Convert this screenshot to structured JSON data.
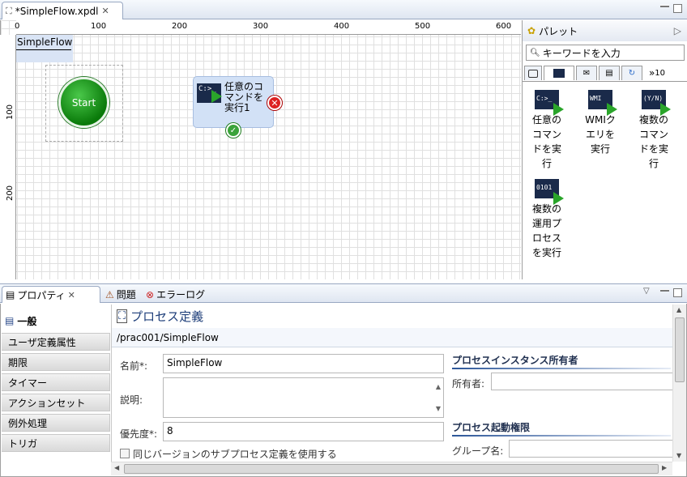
{
  "editor": {
    "tab_title": "*SimpleFlow.xpdl"
  },
  "ruler": {
    "top_ticks": [
      "0",
      "100",
      "200",
      "300",
      "400",
      "500",
      "600"
    ],
    "left_ticks": [
      "100",
      "200"
    ]
  },
  "canvas": {
    "flow_name": "SimpleFlow",
    "start_label": "Start",
    "task": {
      "label_line1": "任意のコ",
      "label_line2": "マンドを",
      "label_line3": "実行1",
      "icon_text": "C:>_"
    }
  },
  "palette": {
    "title": "パレット",
    "search_placeholder": "キーワードを入力",
    "tab_overflow": "»",
    "tab_count": "10",
    "items": [
      {
        "icon_text": "C:>_",
        "line1": "任意の",
        "line2": "コマン",
        "line3": "ドを実",
        "line4": "行"
      },
      {
        "icon_text": "WMI",
        "line1": "WMIク",
        "line2": "エリを",
        "line3": "実行",
        "line4": ""
      },
      {
        "icon_text": "(Y/N)",
        "line1": "複数の",
        "line2": "コマン",
        "line3": "ドを実",
        "line4": "行"
      },
      {
        "icon_text": "0101",
        "line1": "複数の",
        "line2": "運用プ",
        "line3": "ロセス",
        "line4": "を実行"
      }
    ]
  },
  "bottom_tabs": {
    "properties": "プロパティ",
    "problems": "問題",
    "error_log": "エラーログ"
  },
  "sidebar": {
    "items": [
      "一般",
      "ユーザ定義属性",
      "期限",
      "タイマー",
      "アクションセット",
      "例外処理",
      "トリガ"
    ]
  },
  "detail": {
    "title": "プロセス定義",
    "path": "/prac001/SimpleFlow",
    "name_label": "名前*:",
    "name_value": "SimpleFlow",
    "desc_label": "説明:",
    "priority_label": "優先度*:",
    "priority_value": "8",
    "same_version_label": "同じバージョンのサブプロセス定義を使用する",
    "owner_section": "プロセスインスタンス所有者",
    "owner_label": "所有者:",
    "start_section": "プロセス起動権限",
    "group_label": "グループ名:"
  }
}
